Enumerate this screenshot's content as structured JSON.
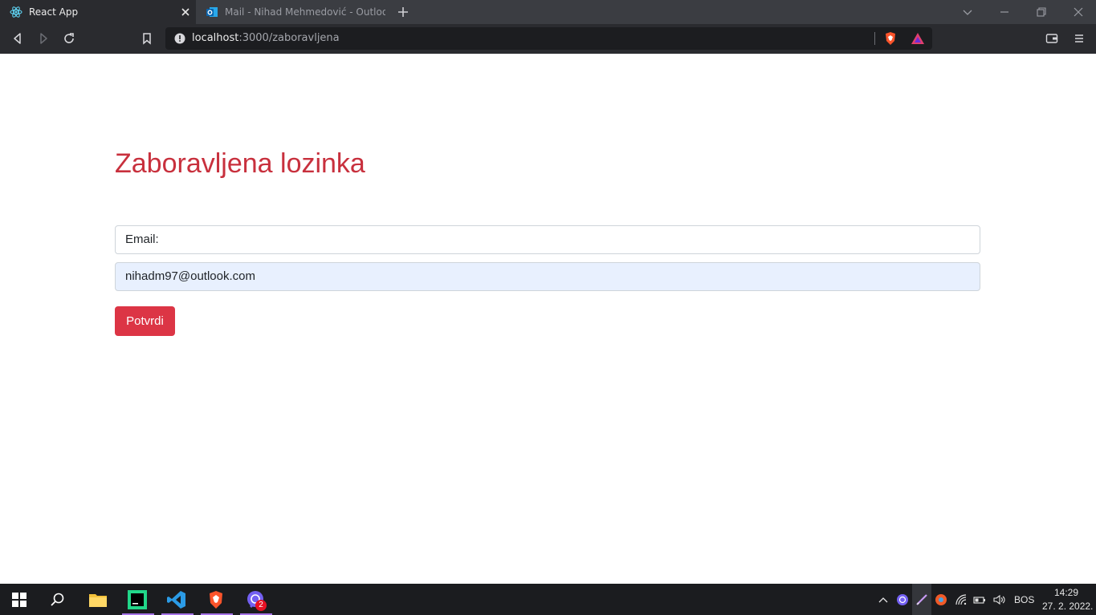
{
  "browser": {
    "tabs": [
      {
        "title": "React App",
        "icon": "react-icon",
        "active": true
      },
      {
        "title": "Mail - Nihad Mehmedović - Outlook",
        "icon": "outlook-icon",
        "active": false
      }
    ],
    "url_host": "localhost",
    "url_path": ":3000/zaboravljena"
  },
  "page": {
    "heading": "Zaboravljena lozinka",
    "email_label": "Email:",
    "email_value": "nihadm97@outlook.com",
    "submit_label": "Potvrdi",
    "colors": {
      "accent": "#dc3545",
      "heading": "#c8303d",
      "autofill": "#e8f0fe"
    }
  },
  "taskbar": {
    "apps": [
      "start-icon",
      "search-icon",
      "file-explorer-icon",
      "pycharm-icon",
      "vscode-icon",
      "brave-icon",
      "viber-icon"
    ],
    "viber_badge": "2",
    "language": "BOS",
    "time": "14:29",
    "date": "27. 2. 2022."
  }
}
